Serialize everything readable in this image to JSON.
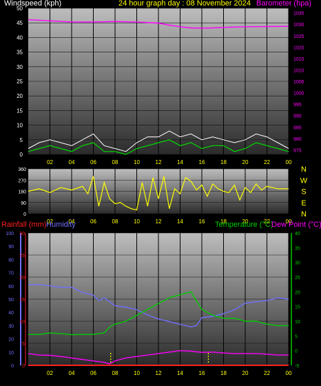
{
  "header": {
    "windspeed_label": "Windspeed (kph)",
    "title": "24 hour graph day : 08 November 2024",
    "barometer_label": "Barometer (hpa)",
    "rainfall_label": "Rainfall (mm)",
    "humidity_label": "Humidity",
    "temperature_label": "Temperature (°C)",
    "dewpoint_label": "Dew Point (°C)"
  },
  "colors": {
    "windspeed_text": "#ffffff",
    "title_text": "#ffff00",
    "barometer": "#ff00ff",
    "rainfall": "#ff2020",
    "humidity": "#7070ff",
    "temperature": "#00cc00",
    "dewpoint": "#ff00ff",
    "wind_gust": "#ffffff",
    "wind_avg": "#00dd00",
    "direction": "#ffff00",
    "marker": "#ffff00"
  },
  "chart_data": [
    {
      "type": "line",
      "name": "wind-and-pressure",
      "x_ticks": [
        "02",
        "04",
        "06",
        "08",
        "10",
        "12",
        "14",
        "16",
        "18",
        "20",
        "22",
        "00"
      ],
      "xlim": [
        0,
        24
      ],
      "y_left": {
        "label": "Windspeed (kph)",
        "ticks": [
          0,
          5,
          10,
          15,
          20,
          25,
          30,
          35,
          40,
          45,
          50
        ],
        "ylim": [
          0,
          50
        ]
      },
      "y_right": {
        "label": "Barometer (hpa)",
        "ticks": [
          975,
          980,
          985,
          990,
          995,
          1000,
          1005,
          1010,
          1015,
          1020,
          1025,
          1030,
          1035
        ],
        "ylim": [
          973,
          1037
        ]
      },
      "series": [
        {
          "name": "Barometer (hpa)",
          "axis": "right",
          "x": [
            0,
            2,
            4,
            6,
            8,
            10,
            12,
            13,
            14,
            15,
            16,
            17,
            18,
            20,
            22,
            24
          ],
          "y": [
            1032,
            1031.5,
            1031,
            1031,
            1031.2,
            1031,
            1030.5,
            1029.6,
            1028.9,
            1028.4,
            1028.3,
            1028.4,
            1028.6,
            1028.9,
            1029,
            1029.1
          ]
        },
        {
          "name": "Windspeed (kph)",
          "axis": "left",
          "x": [
            0,
            1,
            2,
            3,
            4,
            5,
            6,
            7,
            8,
            9,
            10,
            11,
            12,
            13,
            14,
            15,
            16,
            17,
            18,
            19,
            20,
            21,
            22,
            23,
            24
          ],
          "y": [
            1,
            2,
            3,
            2,
            1,
            3,
            4,
            1,
            1,
            0,
            2,
            3,
            4,
            5,
            3,
            4,
            2,
            3,
            3,
            1,
            2,
            4,
            3,
            2,
            1
          ]
        },
        {
          "name": "Wind gust",
          "axis": "left",
          "x": [
            0,
            1,
            2,
            3,
            4,
            5,
            6,
            7,
            8,
            9,
            10,
            11,
            12,
            13,
            14,
            15,
            16,
            17,
            18,
            19,
            20,
            21,
            22,
            23,
            24
          ],
          "y": [
            2,
            4,
            5,
            4,
            3,
            5,
            7,
            3,
            2,
            1,
            4,
            6,
            6,
            8,
            6,
            7,
            5,
            6,
            5,
            4,
            5,
            7,
            6,
            4,
            2
          ]
        }
      ]
    },
    {
      "type": "line",
      "name": "wind-direction",
      "x_ticks": [
        "02",
        "04",
        "06",
        "08",
        "10",
        "12",
        "14",
        "16",
        "18",
        "20",
        "22",
        "00"
      ],
      "xlim": [
        0,
        24
      ],
      "y_left": {
        "ticks": [
          0,
          90,
          180,
          270,
          360
        ],
        "ylim": [
          0,
          360
        ]
      },
      "compass": [
        "N",
        "W",
        "S",
        "E",
        "N"
      ],
      "series": [
        {
          "name": "Wind direction",
          "x": [
            0,
            1,
            2,
            3,
            4,
            5,
            5.5,
            6,
            6.5,
            7,
            7.5,
            8,
            8.5,
            9,
            9.5,
            10,
            10.5,
            11,
            11.5,
            12,
            12.5,
            13,
            13.5,
            14,
            14.5,
            15,
            15.5,
            16,
            16.5,
            17,
            17.5,
            18,
            18.5,
            19,
            19.5,
            20,
            20.5,
            21,
            21.5,
            22,
            22.5,
            23,
            24
          ],
          "y": [
            180,
            200,
            170,
            210,
            190,
            220,
            160,
            300,
            60,
            250,
            120,
            80,
            90,
            60,
            40,
            30,
            250,
            60,
            290,
            120,
            300,
            40,
            200,
            160,
            290,
            260,
            190,
            230,
            140,
            240,
            200,
            180,
            170,
            230,
            110,
            210,
            170,
            240,
            190,
            220,
            210,
            200,
            200
          ]
        }
      ]
    },
    {
      "type": "line",
      "name": "rain-humidity-temp",
      "x_ticks": [
        "02",
        "04",
        "06",
        "08",
        "10",
        "12",
        "14",
        "16",
        "18",
        "20",
        "22",
        "00"
      ],
      "xlim": [
        0,
        24
      ],
      "y_left": {
        "label": "Rainfall (mm)",
        "ticks": [
          0,
          5,
          10,
          15,
          20,
          25,
          30
        ],
        "ylim": [
          0,
          30
        ]
      },
      "y_humidity": {
        "label": "Humidity",
        "ticks": [
          0,
          10,
          20,
          30,
          40,
          50,
          60,
          70,
          80,
          90,
          100
        ],
        "ylim": [
          0,
          100
        ]
      },
      "y_right": {
        "label": "Temperature (°C)",
        "ticks": [
          -5,
          0,
          5,
          10,
          15,
          20,
          25,
          30,
          35,
          40
        ],
        "ylim": [
          -5,
          40
        ]
      },
      "series": [
        {
          "name": "Humidity",
          "axis": "humidity",
          "x": [
            0,
            1,
            2,
            3,
            4,
            5,
            6,
            6.5,
            7,
            8,
            9,
            10,
            11,
            12,
            13,
            14,
            15,
            15.5,
            16,
            17,
            18,
            19,
            20,
            21,
            22,
            23,
            24
          ],
          "y": [
            61,
            61,
            60,
            59,
            59,
            55,
            53,
            49,
            51,
            45,
            44,
            42,
            38,
            35,
            33,
            31,
            29,
            30,
            36,
            37,
            39,
            42,
            47,
            48,
            49,
            51,
            50
          ]
        },
        {
          "name": "Temperature (°C)",
          "axis": "right",
          "x": [
            0,
            1,
            2,
            3,
            4,
            5,
            6,
            6.5,
            7,
            7.5,
            8,
            9,
            10,
            11,
            12,
            13,
            14,
            15,
            15.5,
            16,
            17,
            18,
            19,
            20,
            21,
            22,
            23,
            24
          ],
          "y": [
            5.5,
            5.5,
            6,
            5.8,
            5.4,
            5.5,
            5.5,
            5.8,
            6,
            8,
            9,
            10,
            12,
            14,
            16,
            18,
            19,
            20,
            17,
            14,
            12,
            11,
            11,
            10,
            10,
            9,
            8.5,
            8.5
          ]
        },
        {
          "name": "Dew Point (°C)",
          "axis": "right",
          "x": [
            0,
            1,
            2,
            3,
            4,
            5,
            6,
            7,
            7.5,
            8,
            9,
            10,
            11,
            12,
            13,
            14,
            15,
            16,
            17,
            18,
            19,
            20,
            21,
            22,
            23,
            24
          ],
          "y": [
            -1,
            -1.5,
            -1.6,
            -2,
            -2.5,
            -3,
            -3.5,
            -4,
            -4.5,
            -3.5,
            -2.5,
            -2,
            -1.5,
            -1,
            -0.5,
            0,
            -0.2,
            -0.6,
            -0.5,
            -0.8,
            -1,
            -1,
            -1,
            -1.2,
            -1.5,
            -1.5
          ]
        },
        {
          "name": "Rainfall (mm)",
          "axis": "left",
          "x": [
            0,
            24
          ],
          "y": [
            0,
            0
          ]
        }
      ]
    }
  ]
}
